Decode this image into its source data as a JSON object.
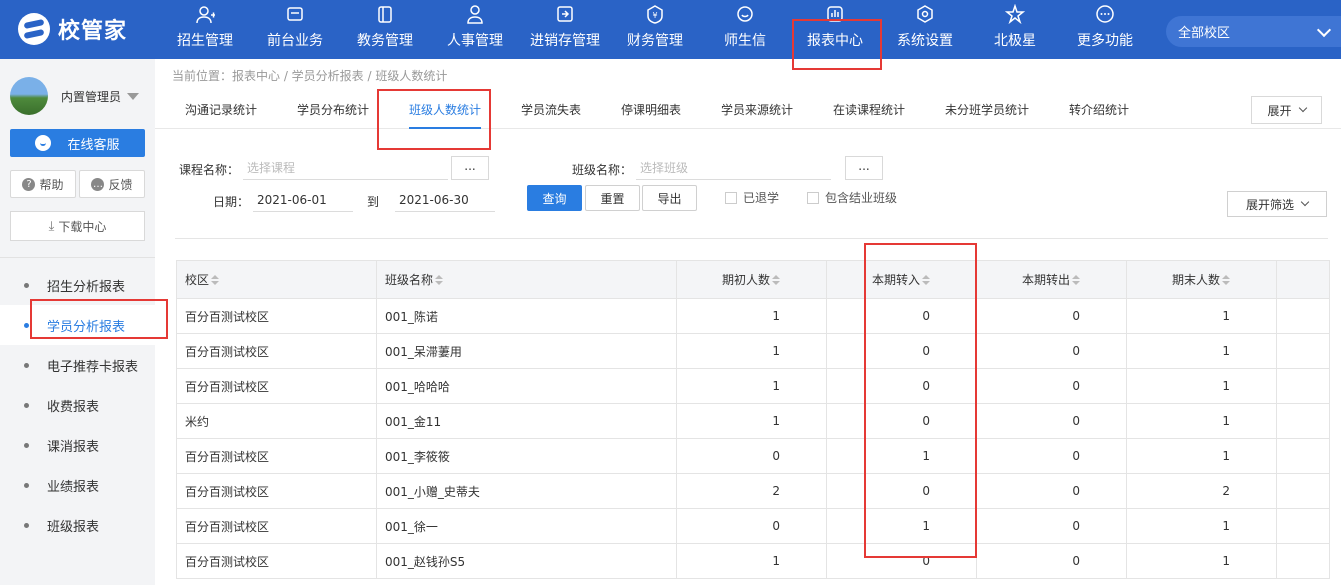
{
  "app": {
    "logo_text": "校管家"
  },
  "nav": [
    {
      "label": "招生管理",
      "icon": "user-plus-icon"
    },
    {
      "label": "前台业务",
      "icon": "desk-icon"
    },
    {
      "label": "教务管理",
      "icon": "book-icon"
    },
    {
      "label": "人事管理",
      "icon": "person-icon"
    },
    {
      "label": "进销存管理",
      "icon": "inventory-icon"
    },
    {
      "label": "财务管理",
      "icon": "finance-icon"
    },
    {
      "label": "师生信",
      "icon": "message-icon"
    },
    {
      "label": "报表中心",
      "icon": "report-icon",
      "active": true
    },
    {
      "label": "系统设置",
      "icon": "settings-icon"
    },
    {
      "label": "北极星",
      "icon": "star-icon"
    },
    {
      "label": "更多功能",
      "icon": "more-icon"
    }
  ],
  "campus_select": {
    "value": "全部校区"
  },
  "sidebar": {
    "user_name": "内置管理员",
    "service_label": "在线客服",
    "help_label": "帮助",
    "feedback_label": "反馈",
    "download_label": "下载中心",
    "items": [
      {
        "label": "招生分析报表"
      },
      {
        "label": "学员分析报表",
        "active": true
      },
      {
        "label": "电子推荐卡报表"
      },
      {
        "label": "收费报表"
      },
      {
        "label": "课消报表"
      },
      {
        "label": "业绩报表"
      },
      {
        "label": "班级报表"
      }
    ]
  },
  "breadcrumb": "当前位置：报表中心 / 学员分析报表 / 班级人数统计",
  "tabs": [
    {
      "label": "沟通记录统计"
    },
    {
      "label": "学员分布统计"
    },
    {
      "label": "班级人数统计",
      "active": true
    },
    {
      "label": "学员流失表"
    },
    {
      "label": "停课明细表"
    },
    {
      "label": "学员来源统计"
    },
    {
      "label": "在读课程统计"
    },
    {
      "label": "未分班学员统计"
    },
    {
      "label": "转介绍统计"
    }
  ],
  "expand_label": "展开",
  "filters": {
    "course_label": "课程名称：",
    "course_placeholder": "选择课程",
    "class_label": "班级名称：",
    "class_placeholder": "选择班级",
    "dots": "...",
    "date_label": "日期：",
    "date_from": "2021-06-01",
    "date_to_label": "到",
    "date_to": "2021-06-30",
    "query_label": "查询",
    "reset_label": "重置",
    "export_label": "导出",
    "withdrawn_label": "已退学",
    "include_graduated_label": "包含结业班级",
    "expand_filter_label": "展开筛选"
  },
  "table": {
    "headers": [
      "校区",
      "班级名称",
      "期初人数",
      "本期转入",
      "本期转出",
      "期末人数"
    ],
    "rows": [
      [
        "百分百测试校区",
        "001_陈诺",
        "1",
        "0",
        "0",
        "1"
      ],
      [
        "百分百测试校区",
        "001_呆滞萋用",
        "1",
        "0",
        "0",
        "1"
      ],
      [
        "百分百测试校区",
        "001_哈哈哈",
        "1",
        "0",
        "0",
        "1"
      ],
      [
        "米约",
        "001_金11",
        "1",
        "0",
        "0",
        "1"
      ],
      [
        "百分百测试校区",
        "001_李筱筱",
        "0",
        "1",
        "0",
        "1"
      ],
      [
        "百分百测试校区",
        "001_小赠_史蒂夫",
        "2",
        "0",
        "0",
        "2"
      ],
      [
        "百分百测试校区",
        "001_徐一",
        "0",
        "1",
        "0",
        "1"
      ],
      [
        "百分百测试校区",
        "001_赵钱孙S5",
        "1",
        "0",
        "0",
        "1"
      ]
    ]
  },
  "colors": {
    "topbar": "#2a63c6",
    "accent": "#2a7de1",
    "highlight": "#e53935"
  }
}
